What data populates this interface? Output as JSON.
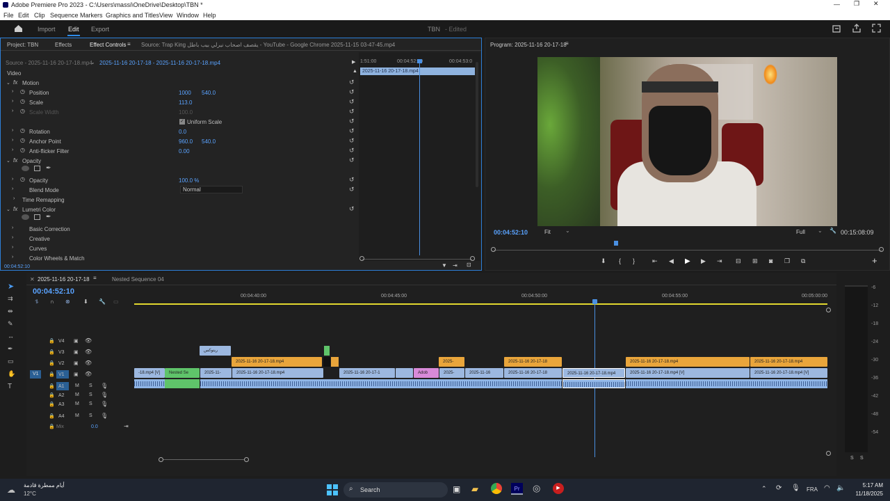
{
  "title_bar": {
    "title": "Adobe Premiere Pro 2023 - C:\\Users\\massi\\OneDrive\\Desktop\\TBN *"
  },
  "menu": [
    "File",
    "Edit",
    "Clip",
    "Sequence",
    "Markers",
    "Graphics and Titles",
    "View",
    "Window",
    "Help"
  ],
  "app_bar": {
    "tabs": [
      "Import",
      "Edit",
      "Export"
    ],
    "active": "Edit",
    "project_name": "TBN",
    "project_status": "- Edited"
  },
  "effect_controls": {
    "tabs": [
      "Project: TBN",
      "Effects",
      "Effect Controls",
      "Source: Trap King يقصف اصحاب نيرلي بيب باطل - YouTube - Google Chrome 2025-11-15 03-47-45.mp4"
    ],
    "source_label": "Source - 2025-11-16 20-17-18.mp4",
    "sequence_label": "2025-11-16 20-17-18 - 2025-11-16 20-17-18.mp4",
    "section_video": "Video",
    "props": [
      {
        "name": "Motion",
        "type": "fx"
      },
      {
        "name": "Position",
        "v1": "1000",
        "v2": "540.0"
      },
      {
        "name": "Scale",
        "v1": "113.0"
      },
      {
        "name": "Scale Width",
        "v1": "100.0",
        "disabled": true
      },
      {
        "name": "Uniform Scale",
        "type": "checkbox"
      },
      {
        "name": "Rotation",
        "v1": "0.0"
      },
      {
        "name": "Anchor Point",
        "v1": "960.0",
        "v2": "540.0"
      },
      {
        "name": "Anti-flicker Filter",
        "v1": "0.00"
      },
      {
        "name": "Opacity",
        "type": "fx"
      },
      {
        "name": "Opacity",
        "v1": "100.0 %"
      },
      {
        "name": "Blend Mode",
        "v1": "Normal",
        "type": "dropdown"
      },
      {
        "name": "Time Remapping",
        "type": "section"
      },
      {
        "name": "Lumetri Color",
        "type": "fx"
      },
      {
        "name": "Basic Correction"
      },
      {
        "name": "Creative"
      },
      {
        "name": "Curves"
      },
      {
        "name": "Color Wheels & Match"
      }
    ],
    "ruler": [
      "1:51:00",
      "00:04:52:00",
      "00:04:53:0"
    ],
    "clip_name": "2025-11-16 20-17-18.mp4",
    "timecode": "00:04:52:10"
  },
  "program_monitor": {
    "title": "Program: 2025-11-16 20-17-18",
    "timecode": "00:04:52:10",
    "fit": "Fit",
    "quality": "Full",
    "duration": "00:15:08:09"
  },
  "timeline": {
    "tabs": [
      "2025-11-16 20-17-18",
      "Nested Sequence 04"
    ],
    "timecode": "00:04:52:10",
    "ruler": [
      "00:04:40:00",
      "00:04:45:00",
      "00:04:50:00",
      "00:04:55:00",
      "00:05:00:00"
    ],
    "tracks": [
      "V4",
      "V3",
      "V2",
      "V1",
      "A1",
      "A2",
      "A3",
      "A4"
    ],
    "mix": "Mix",
    "mix_value": "0.0",
    "clips_v3": [
      "ريتوكس"
    ],
    "clips_v2": [
      "2025-11-16 20-17-18.mp4",
      "2025-",
      "2025-11-16 20-17-18",
      "2025-11-16 20-17-18.mp4",
      "2025-11-16 20-17-18.mp4"
    ],
    "clips_v1": [
      "-18.mp4 [V]",
      "Nested Se",
      "2025-11-",
      "2025-11-16 20-17-18.mp4",
      "2025-11-16 20-17-1",
      "Adob",
      "2025-",
      "2025-11-16",
      "2025-11-16 20-17-18",
      "2025-11-16 20-17-18.mp4",
      "2025-11-16 20-17-18.mp4 [V]",
      "2025-11-16 20-17-18.mp4 [V]"
    ],
    "meter_scale": [
      "-6",
      "-12",
      "-18",
      "-24",
      "-30",
      "-36",
      "-42",
      "-48",
      "-54"
    ],
    "meter_footer": [
      "S",
      "S"
    ]
  },
  "taskbar": {
    "weather": "أيام ممطرة قادمة",
    "temp": "12°C",
    "search": "Search",
    "lang": "FRA",
    "time": "5:17 AM",
    "date": "11/18/2025"
  }
}
